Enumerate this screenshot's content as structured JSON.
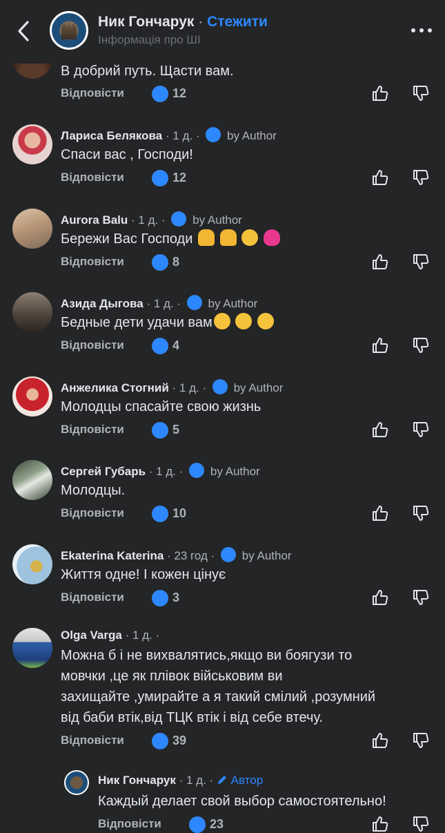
{
  "header": {
    "name": "Ник Гончарук",
    "dot": "·",
    "follow": "Стежити",
    "subtitle": "Інформація про ШІ"
  },
  "reply_label": "Відповісти",
  "comments": [
    {
      "text": "В добрий путь. Щасти вам.",
      "likes": "12"
    },
    {
      "name": "Лариса Белякова",
      "time": "1 д.",
      "by": "by Author",
      "text": "Спаси вас , Господи!",
      "likes": "12"
    },
    {
      "name": "Aurora Balu",
      "time": "1 д.",
      "by": "by Author",
      "text": "Бережи Вас Господи",
      "likes": "8"
    },
    {
      "name": "Азида Дыгова",
      "time": "1 д.",
      "by": "by Author",
      "text": "Бедные дети удачи вам",
      "likes": "4"
    },
    {
      "name": "Анжелика Стогний",
      "time": "1 д.",
      "by": "by Author",
      "text": "Молодцы спасайте свою жизнь",
      "likes": "5"
    },
    {
      "name": "Сергей Губарь",
      "time": "1 д.",
      "by": "by Author",
      "text": "Молодцы.",
      "likes": "10"
    },
    {
      "name": "Ekaterina Katerina",
      "time": "23 год",
      "by": "by Author",
      "text": "Життя одне! І кожен цінує",
      "likes": "3"
    },
    {
      "name": "Olga Varga",
      "time": "1 д.",
      "text_lines": [
        "Можна б і не вихвалятись,якщо ви боягузи то",
        "мовчки ,це як плівок військовим ви",
        "захищайте ,умирайте а я такий смілий ,розумний",
        "від баби втік,від ТЦК втік і від себе втечу."
      ],
      "likes": "39"
    },
    {
      "name": "Ник Гончарук",
      "time": "1 д.",
      "author_badge": "Автор",
      "text": "Каждый делает свой выбор самостоятельно!",
      "likes": "23"
    }
  ],
  "colors": {
    "bg": "#242526",
    "text": "#e4e6eb",
    "muted": "#b0b3b8",
    "accent": "#2d88ff"
  }
}
